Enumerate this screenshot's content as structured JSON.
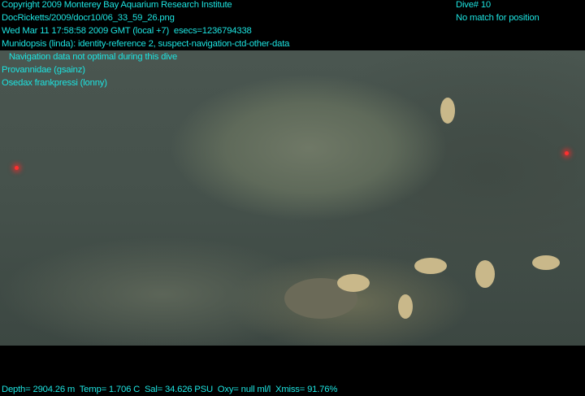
{
  "overlay": {
    "copyright": "Copyright 2009 Monterey Bay Aquarium Research Institute",
    "file": "DocRicketts/2009/docr10/06_33_59_26.png",
    "datetime": "Wed Mar 11 17:58:58 2009 GMT (local +7)  esecs=1236794338",
    "annotation1": "Munidopsis (linda): identity-reference 2, suspect-navigation-ctd-other-data",
    "annotation1_note": "   Navigation data not optimal during this dive",
    "annotation2": "Provannidae (gsainz)",
    "annotation3": "Osedax frankpressi (lonny)",
    "dive": "Dive# 10",
    "position": "No match for position",
    "sensors": "Depth= 2904.26 m  Temp= 1.706 C  Sal= 34.626 PSU  Oxy= null ml/l  Xmiss= 91.76%"
  },
  "colors": {
    "overlay_text": "#1de3e0",
    "laser": "#ff3030"
  }
}
